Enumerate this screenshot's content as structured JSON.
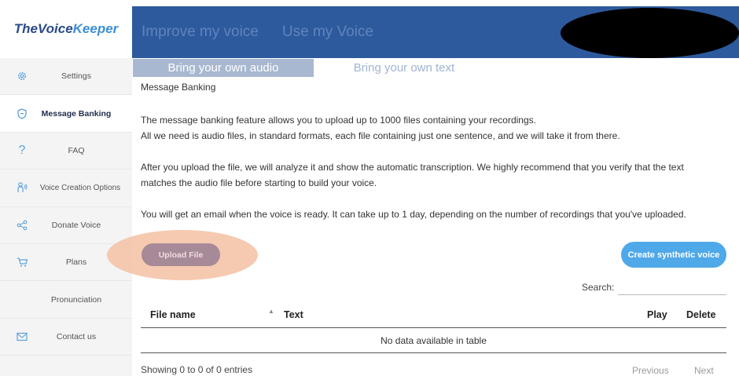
{
  "brand": {
    "part1": "TheVoice",
    "part2": "Keeper"
  },
  "header": {
    "nav": [
      "Improve my voice",
      "Use my Voice"
    ]
  },
  "sidebar": {
    "items": [
      {
        "label": "Settings",
        "icon": "gear-icon",
        "active": false
      },
      {
        "label": "Message Banking",
        "icon": "shield-icon",
        "active": true
      },
      {
        "label": "FAQ",
        "icon": "question-icon",
        "active": false
      },
      {
        "label": "Voice Creation Options",
        "icon": "person-voice-icon",
        "active": false
      },
      {
        "label": "Donate Voice",
        "icon": "share-icon",
        "active": false
      },
      {
        "label": "Plans",
        "icon": "cart-icon",
        "active": false
      },
      {
        "label": "Pronunciation",
        "icon": "",
        "active": false
      },
      {
        "label": "Contact us",
        "icon": "mail-icon",
        "active": false
      }
    ]
  },
  "tabs": {
    "own_audio": "Bring your own audio",
    "own_text": "Bring your own text"
  },
  "main": {
    "title": "Message Banking",
    "para1_line1": "The message banking feature allows you to upload up to 1000 files containing your recordings.",
    "para1_line2": "All we need is audio files, in standard formats, each file containing just one sentence, and we will take it from there.",
    "para2_line1": "After you upload the file, we will analyze it and show the automatic transcription. We highly recommend that you verify that the text",
    "para2_line2": "matches the audio file before starting to build your voice.",
    "para3": "You will get an email when the voice is ready. It can take up to 1 day, depending on the number of recordings that you've uploaded.",
    "upload_label": "Upload File",
    "synth_label": "Create synthetic voice",
    "search_label": "Search:",
    "search_value": ""
  },
  "table": {
    "headers": {
      "file": "File name",
      "text": "Text",
      "play": "Play",
      "delete": "Delete"
    },
    "empty": "No data available in table",
    "showing": "Showing 0 to 0 of 0 entries",
    "previous": "Previous",
    "next": "Next"
  },
  "colors": {
    "header": "#2d5a9c",
    "accent": "#4fa8e8",
    "upload": "#a68a97",
    "halo": "#f4c4a8"
  }
}
